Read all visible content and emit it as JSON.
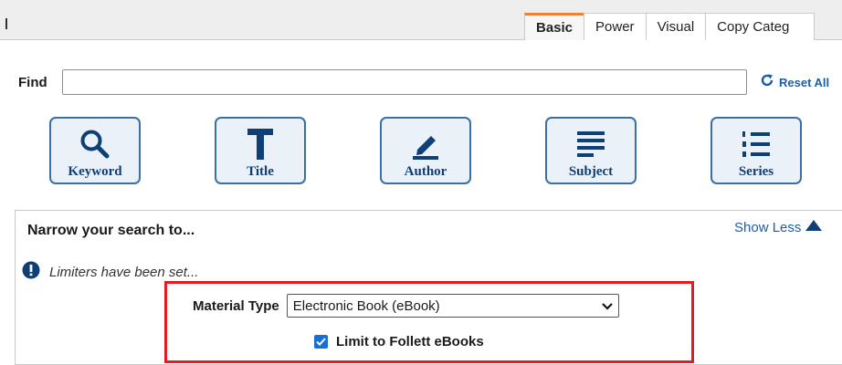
{
  "tabs": [
    {
      "label": "Basic",
      "active": true
    },
    {
      "label": "Power",
      "active": false
    },
    {
      "label": "Visual",
      "active": false
    },
    {
      "label": "Copy Categ",
      "active": false
    }
  ],
  "find": {
    "label": "Find",
    "value": "",
    "reset_label": "Reset All"
  },
  "search_buttons": [
    {
      "label": "Keyword",
      "icon": "magnifier-icon"
    },
    {
      "label": "Title",
      "icon": "title-t-icon"
    },
    {
      "label": "Author",
      "icon": "pencil-icon"
    },
    {
      "label": "Subject",
      "icon": "lines-icon"
    },
    {
      "label": "Series",
      "icon": "numbered-list-icon"
    }
  ],
  "narrow": {
    "title": "Narrow your search to...",
    "show_less_label": "Show Less",
    "notice": "Limiters have been set...",
    "material_type_label": "Material Type",
    "material_type_value": "Electronic Book (eBook)",
    "limit_label": "Limit to Follett eBooks",
    "limit_checked": true
  },
  "colors": {
    "accent_blue": "#1b5ea8",
    "button_border": "#3a6fa8",
    "active_tab": "#e8833a",
    "highlight_red": "#e31b23"
  }
}
